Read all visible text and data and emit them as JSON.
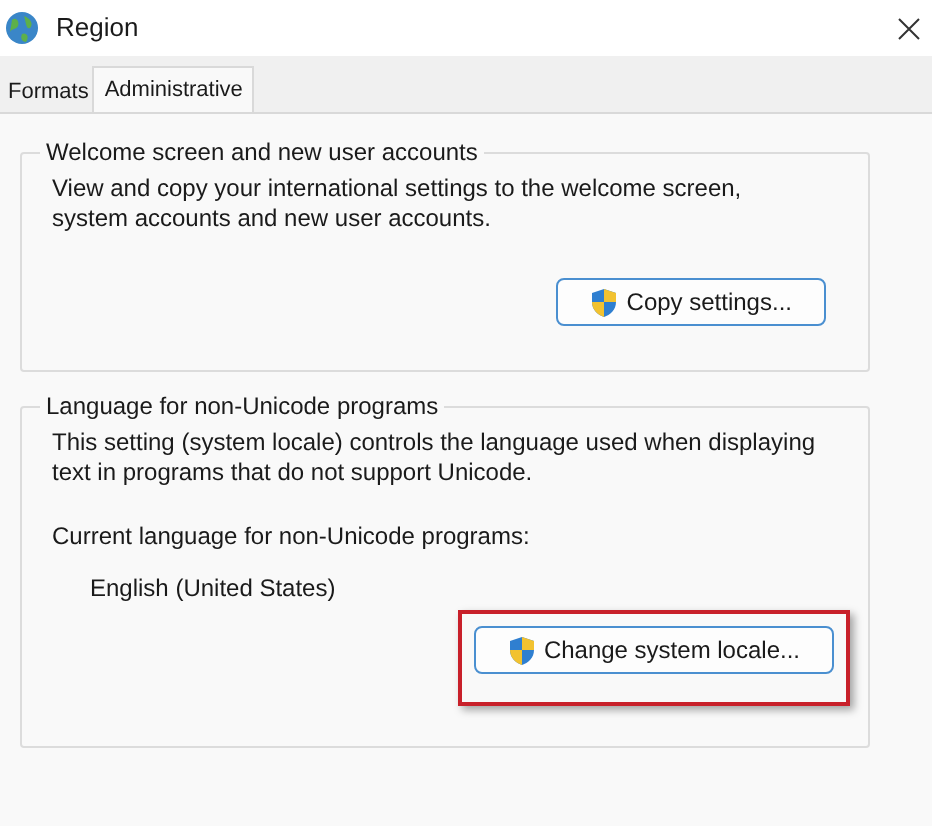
{
  "window": {
    "title": "Region"
  },
  "tabs": [
    {
      "label": "Formats",
      "selected": false
    },
    {
      "label": "Administrative",
      "selected": true
    }
  ],
  "groups": [
    {
      "title": "Welcome screen and new user accounts",
      "description": "View and copy your international settings to the welcome screen, system accounts and new user accounts.",
      "button": {
        "label": "Copy settings...",
        "highlighted": false
      }
    },
    {
      "title": "Language for non-Unicode programs",
      "description": "This setting (system locale) controls the language used when displaying text in programs that do not support Unicode.",
      "current_label": "Current language for non-Unicode programs:",
      "current_value": "English (United States)",
      "button": {
        "label": "Change system locale...",
        "highlighted": true
      }
    }
  ]
}
